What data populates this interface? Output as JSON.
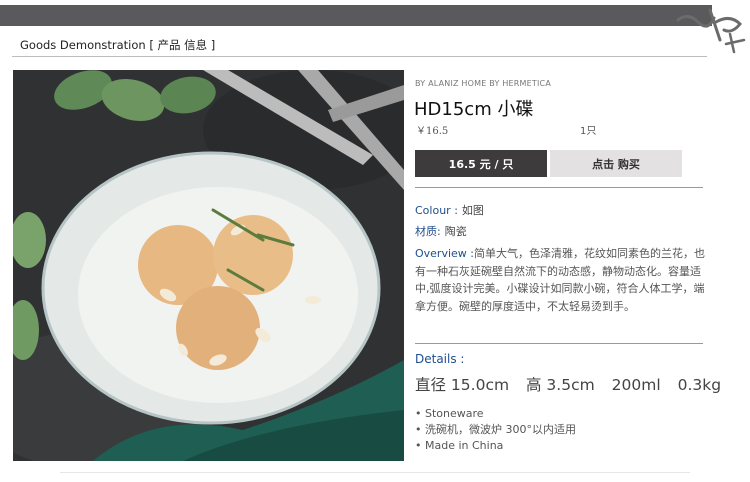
{
  "header": {
    "section_title_en": "Goods  Demonstration",
    "section_title_cn": "[ 产品 信息 ]"
  },
  "product": {
    "brand": "BY ALANIZ HOME BY HERMETICA",
    "title": "HD15cm 小碟",
    "price": "￥16.5",
    "quantity": "1只"
  },
  "buttons": {
    "price_label": "16.5 元 / 只",
    "buy_label": "点击 购买"
  },
  "attributes": {
    "colour_key": "Colour :",
    "colour_value": "如图",
    "material_key": "材质:",
    "material_value": "陶瓷"
  },
  "overview": {
    "key": "Overview :",
    "text": "简单大气，色泽清雅，花纹如同素色的兰花，也有一种石灰延碗壁自然流下的动态感，静物动态化。容量适中,弧度设计完美。小碟设计如同款小碗，符合人体工学，端拿方便。碗壁的厚度适中，不太轻易烫到手。"
  },
  "details": {
    "label": "Details :",
    "diameter": "直径 15.0cm",
    "height": "高 3.5cm",
    "volume": "200ml",
    "weight": "0.3kg",
    "features": [
      "Stoneware",
      "洗碗机，微波炉 300°以内适用",
      "Made in China"
    ]
  },
  "colors": {
    "accent_blue": "#1f4e8c",
    "topbar": "#5a5a5c",
    "button_dark": "#3e3b3c",
    "button_light": "#e3e1e1"
  }
}
